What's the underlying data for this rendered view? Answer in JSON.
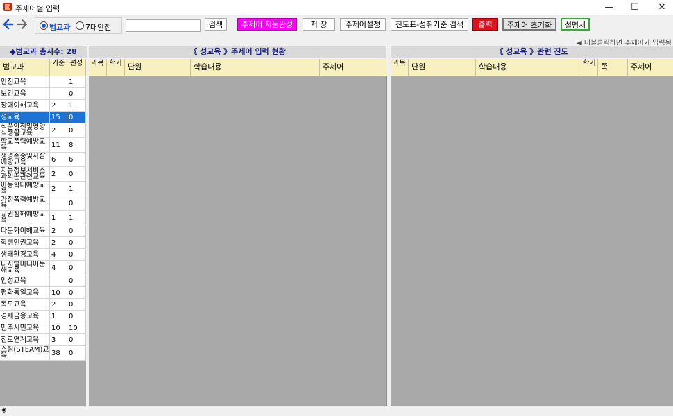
{
  "window": {
    "title": "주제어별 입력",
    "minimize": "—",
    "maximize": "☐",
    "close": "✕"
  },
  "toolbar": {
    "radio_subject": "범교과",
    "radio_safety": "7대안전",
    "search_button": "검색",
    "autocomplete_button": "주제어 자동완성",
    "save_button": "저 장",
    "keyword_settings_button": "주제어설정",
    "progress_search_button": "진도표-성취기준 검색",
    "print_button": "출력",
    "reset_button": "주제어 초기화",
    "manual_button": "설명서",
    "colors": {
      "autocomplete": "#ff00ff",
      "print": "#e0101e",
      "manual_border": "#2db030"
    }
  },
  "note": "◀ 더블클릭하면 주제어가 입력됨",
  "left": {
    "title": "◆범교과 총시수: 28",
    "headers": [
      "범교과",
      "기준",
      "편성"
    ],
    "rows": [
      {
        "name": "안전교육",
        "base": "",
        "plan": "1"
      },
      {
        "name": "보건교육",
        "base": "",
        "plan": "0"
      },
      {
        "name": "장애이해교육",
        "base": "2",
        "plan": "1"
      },
      {
        "name": "성교육",
        "base": "15",
        "plan": "0"
      },
      {
        "name": "식품안전및영양 식생활교육",
        "base": "2",
        "plan": "0"
      },
      {
        "name": "학교폭력예방교육",
        "base": "11",
        "plan": "8"
      },
      {
        "name": "생명존중및자살예방교육",
        "base": "6",
        "plan": "6"
      },
      {
        "name": "지능정보서비스과의존관련교육",
        "base": "2",
        "plan": "0"
      },
      {
        "name": "아동학대예방교육",
        "base": "2",
        "plan": "1"
      },
      {
        "name": "가정폭력예방교육",
        "base": "",
        "plan": "0"
      },
      {
        "name": "교권침해예방교육",
        "base": "1",
        "plan": "1"
      },
      {
        "name": "다문화이해교육",
        "base": "2",
        "plan": "0"
      },
      {
        "name": "학생인권교육",
        "base": "2",
        "plan": "0"
      },
      {
        "name": "생태환경교육",
        "base": "4",
        "plan": "0"
      },
      {
        "name": "디지털미디어문해교육",
        "base": "4",
        "plan": "0"
      },
      {
        "name": "인성교육",
        "base": "",
        "plan": "0"
      },
      {
        "name": "평화통일교육",
        "base": "10",
        "plan": "0"
      },
      {
        "name": "독도교육",
        "base": "2",
        "plan": "0"
      },
      {
        "name": "경제금융교육",
        "base": "1",
        "plan": "0"
      },
      {
        "name": "민주시민교육",
        "base": "10",
        "plan": "10"
      },
      {
        "name": "진로연계교육",
        "base": "3",
        "plan": "0"
      },
      {
        "name": "스팀(STEAM)교육",
        "base": "38",
        "plan": "0"
      }
    ]
  },
  "middle": {
    "title": "《 성교육 》주제어 입력 현황",
    "headers": [
      "과목",
      "학기",
      "단원",
      "학습내용",
      "주제어"
    ]
  },
  "right": {
    "title": "《 성교육 》관련 진도",
    "headers": [
      "과목",
      "단원",
      "학습내용",
      "학기",
      "쪽",
      "주제어"
    ]
  },
  "status": "◈"
}
